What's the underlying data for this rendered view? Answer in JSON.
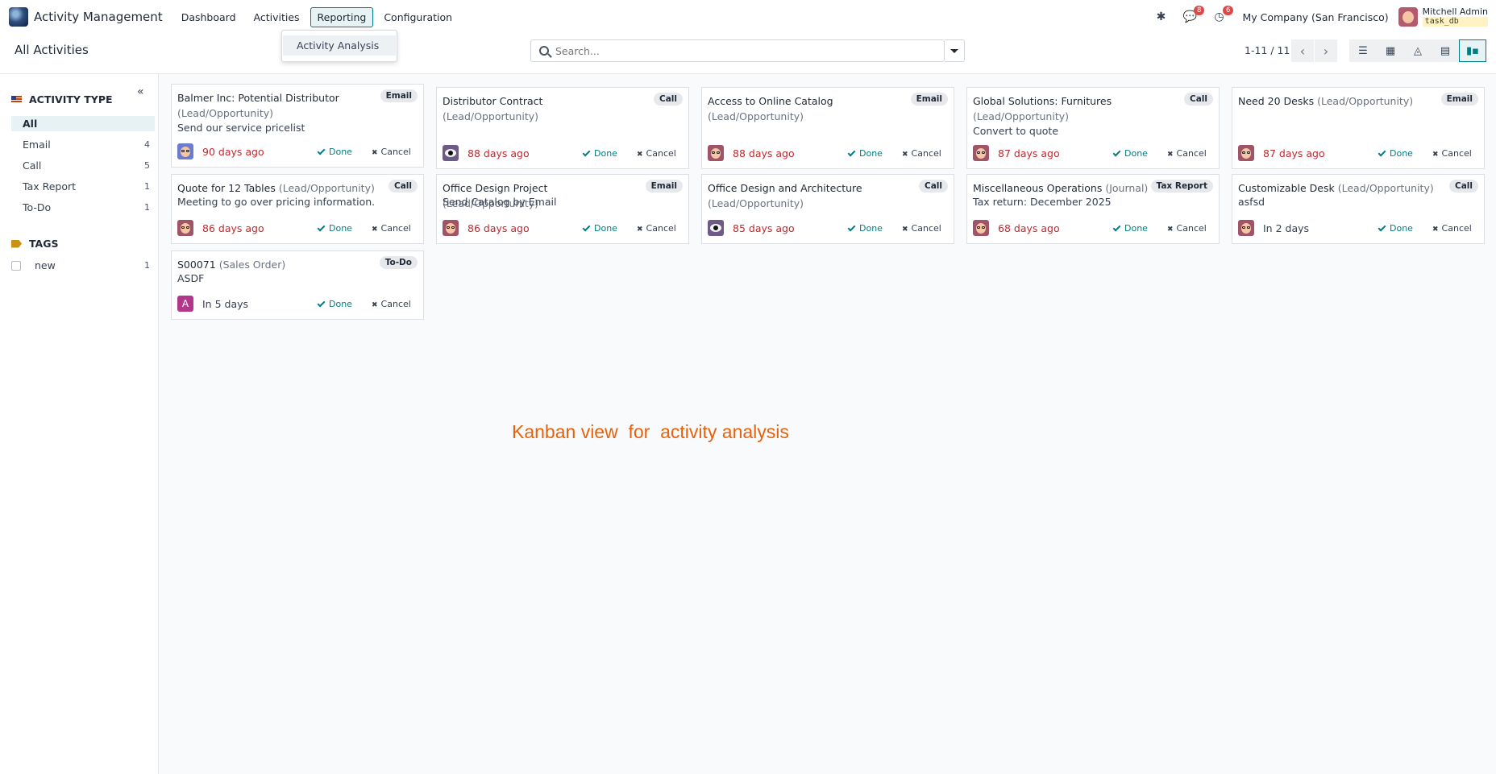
{
  "navbar": {
    "app_name": "Activity Management",
    "menu": [
      "Dashboard",
      "Activities",
      "Reporting",
      "Configuration"
    ],
    "active_menu": "Reporting",
    "chat_badge": "8",
    "activity_badge": "6",
    "company": "My Company (San Francisco)",
    "user_name": "Mitchell Admin",
    "db_name": "task_db"
  },
  "dropdown": {
    "items": [
      "Activity Analysis"
    ]
  },
  "control": {
    "breadcrumb": "All Activities",
    "search_placeholder": "Search...",
    "pager": "1-11 / 11"
  },
  "sidebar": {
    "activity_type_title": "ACTIVITY TYPE",
    "activity_types": [
      {
        "label": "All",
        "count": ""
      },
      {
        "label": "Email",
        "count": "4"
      },
      {
        "label": "Call",
        "count": "5"
      },
      {
        "label": "Tax Report",
        "count": "1"
      },
      {
        "label": "To-Do",
        "count": "1"
      }
    ],
    "tags_title": "TAGS",
    "tags": [
      {
        "label": "new",
        "count": "1"
      }
    ]
  },
  "cards": [
    {
      "title": "Balmer Inc: Potential Distributor",
      "model": "(Lead/Opportunity)",
      "type": "Email",
      "summary": "Send our service pricelist",
      "due": "90 days ago",
      "late": true,
      "avatar": "boy"
    },
    {
      "title": "Distributor Contract",
      "model": "(Lead/Opportunity)",
      "type": "Call",
      "summary": "",
      "due": "88 days ago",
      "late": true,
      "avatar": "cam"
    },
    {
      "title": "Access to Online Catalog",
      "model": "(Lead/Opportunity)",
      "type": "Email",
      "summary": "",
      "due": "88 days ago",
      "late": true,
      "avatar": "admin"
    },
    {
      "title": "Global Solutions: Furnitures",
      "model": "(Lead/Opportunity)",
      "type": "Call",
      "summary": "Convert to quote",
      "due": "87 days ago",
      "late": true,
      "avatar": "admin"
    },
    {
      "title": "Need 20 Desks",
      "model": "(Lead/Opportunity)",
      "type": "Email",
      "summary": "",
      "due": "87 days ago",
      "late": true,
      "avatar": "admin"
    },
    {
      "title": "Quote for 12 Tables",
      "model": "(Lead/Opportunity)",
      "type": "Call",
      "summary": "Meeting to go over pricing information.",
      "due": "86 days ago",
      "late": true,
      "avatar": "admin"
    },
    {
      "title": "Office Design Project",
      "model": "(Lead/Opportunity)",
      "type": "Email",
      "summary": "Send Catalog by Email",
      "due": "86 days ago",
      "late": true,
      "avatar": "admin"
    },
    {
      "title": "Office Design and Architecture",
      "model": "(Lead/Opportunity)",
      "type": "Call",
      "summary": "",
      "due": "85 days ago",
      "late": true,
      "avatar": "cam"
    },
    {
      "title": "Miscellaneous Operations",
      "model": "(Journal)",
      "type": "Tax Report",
      "summary": "Tax return: December 2025",
      "due": "68 days ago",
      "late": true,
      "avatar": "admin"
    },
    {
      "title": "Customizable Desk",
      "model": "(Lead/Opportunity)",
      "type": "Call",
      "summary": "asfsd",
      "due": "In 2 days",
      "late": false,
      "avatar": "admin"
    },
    {
      "title": "S00071",
      "model": "(Sales Order)",
      "type": "To-Do",
      "summary": "ASDF",
      "due": "In 5 days",
      "late": false,
      "avatar": "letter",
      "avatar_letter": "A"
    }
  ],
  "card_actions": {
    "done": "Done",
    "cancel": "Cancel"
  },
  "annotation": "Kanban view  for  activity analysis"
}
